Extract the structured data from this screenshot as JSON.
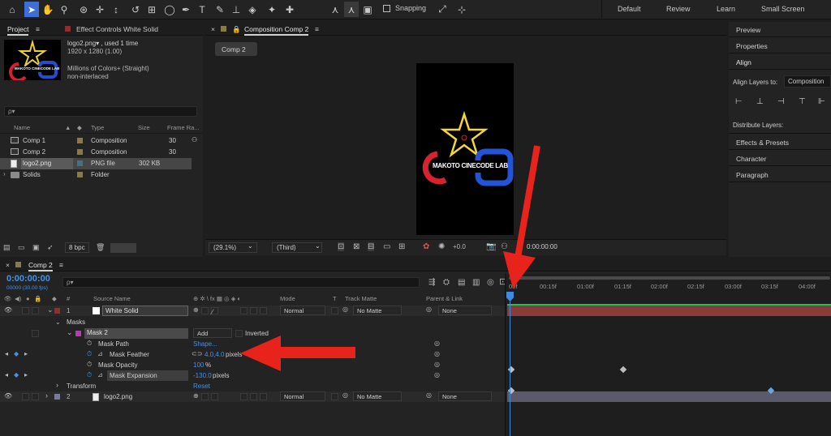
{
  "toolbar": {
    "snapping_label": "Snapping",
    "workspaces": [
      "Default",
      "Review",
      "Learn",
      "Small Screen"
    ]
  },
  "project": {
    "tab_project": "Project",
    "tab_effect": "Effect Controls White Solid",
    "info_name": "logo2.png▾ , used 1 time",
    "info_size": "1920 x 1280 (1.00)",
    "info_colors": "Millions of Colors+ (Straight)",
    "info_interlace": "non-interlaced",
    "search_placeholder": "ρ▾",
    "columns": {
      "name": "Name",
      "type": "Type",
      "size": "Size",
      "frame": "Frame Ra..."
    },
    "items": [
      {
        "name": "Comp 1",
        "type": "Composition",
        "size": "",
        "frame": "30"
      },
      {
        "name": "Comp 2",
        "type": "Composition",
        "size": "",
        "frame": "30"
      },
      {
        "name": "logo2.png",
        "type": "PNG file",
        "size": "302 KB",
        "frame": ""
      },
      {
        "name": "Solids",
        "type": "Folder",
        "size": "",
        "frame": ""
      }
    ],
    "bpc": "8 bpc",
    "thumb_text": "MAKOTO CINECODE LAB"
  },
  "comp": {
    "tab": "Composition Comp 2",
    "chip": "Comp 2",
    "logo_text": "MAKOTO CINECODE LAB",
    "zoom": "(29.1%)",
    "resolution": "(Third)",
    "exposure": "+0.0",
    "time": "0:00:00:00"
  },
  "right": {
    "items": [
      "Preview",
      "Properties",
      "Align"
    ],
    "align_to_label": "Align Layers to:",
    "align_to_value": "Composition",
    "distribute_label": "Distribute Layers:",
    "items2": [
      "Effects & Presets",
      "Character",
      "Paragraph"
    ]
  },
  "timeline": {
    "tab": "Comp 2",
    "timecode": "0:00:00:00",
    "fps": "00000 (30.00 fps)",
    "search_placeholder": "ρ▾",
    "headers": {
      "source": "Source Name",
      "mode": "Mode",
      "t": "T",
      "track": "Track Matte",
      "parent": "Parent & Link"
    },
    "ruler": [
      "00f",
      "00:15f",
      "01:00f",
      "01:15f",
      "02:00f",
      "02:15f",
      "03:00f",
      "03:15f",
      "04:00f"
    ],
    "layer1": {
      "num": "1",
      "name": "White Solid",
      "mode": "Normal",
      "matte": "No Matte",
      "parent": "None"
    },
    "masks_label": "Masks",
    "mask2": {
      "name": "Mask 2",
      "mode": "Add",
      "inverted": "Inverted"
    },
    "props": [
      {
        "name": "Mask Path",
        "value": "Shape..."
      },
      {
        "name": "Mask Feather",
        "value": "4.0,4.0",
        "unit": " pixels"
      },
      {
        "name": "Mask Opacity",
        "value": "100",
        "unit": "%"
      },
      {
        "name": "Mask Expansion",
        "value": "-130.0",
        "unit": " pixels"
      }
    ],
    "transform_label": "Transform",
    "transform_value": "Reset",
    "layer2": {
      "num": "2",
      "name": "logo2.png",
      "mode": "Normal",
      "matte": "No Matte",
      "parent": "None"
    }
  },
  "colors": {
    "accent": "#3d6fd6",
    "arrow": "#e8231c",
    "layer_bar": "#8a3b3b",
    "layer2_bar": "#5a5a6a"
  }
}
